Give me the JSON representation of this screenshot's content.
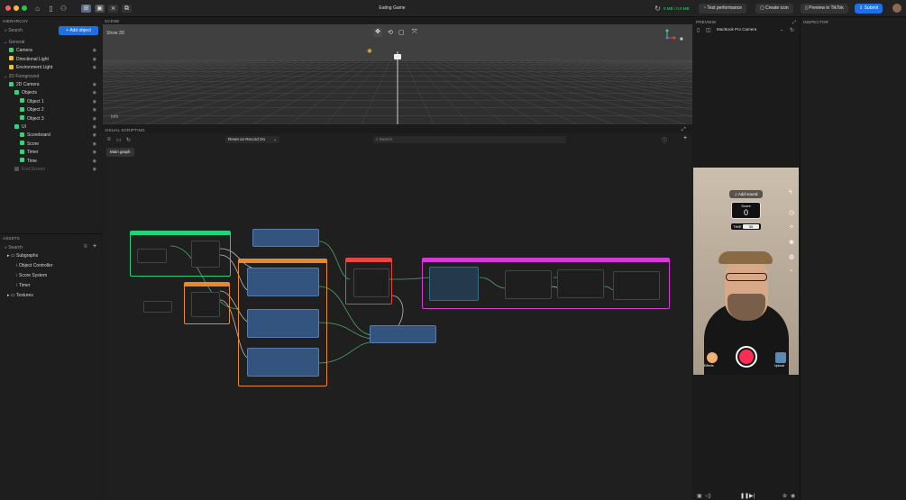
{
  "window": {
    "title": "Eating Game",
    "memory": "0 MB / 0.0 MB"
  },
  "toolbar": {
    "test_performance": "Test performance",
    "create_icon": "Create icon",
    "preview_tiktok": "Preview in TikTok",
    "submit": "Submit"
  },
  "hierarchy": {
    "title": "HIERARCHY",
    "search_placeholder": "Search",
    "add_object": "Add object",
    "rows": [
      {
        "label": "General",
        "indent": 0,
        "kind": "section"
      },
      {
        "label": "Camera",
        "indent": 1,
        "kind": "camera"
      },
      {
        "label": "Directional Light",
        "indent": 1,
        "kind": "light"
      },
      {
        "label": "Environment Light",
        "indent": 1,
        "kind": "light"
      },
      {
        "label": "2D Foreground",
        "indent": 0,
        "kind": "section"
      },
      {
        "label": "2D Camera",
        "indent": 1,
        "kind": "camera"
      },
      {
        "label": "Objects",
        "indent": 2,
        "kind": "group"
      },
      {
        "label": "Object 1",
        "indent": 3,
        "kind": "obj"
      },
      {
        "label": "Object 2",
        "indent": 3,
        "kind": "obj"
      },
      {
        "label": "Object 3",
        "indent": 3,
        "kind": "obj"
      },
      {
        "label": "UI",
        "indent": 2,
        "kind": "group"
      },
      {
        "label": "Scoreboard",
        "indent": 3,
        "kind": "obj"
      },
      {
        "label": "Score",
        "indent": 3,
        "kind": "obj"
      },
      {
        "label": "Timer",
        "indent": 3,
        "kind": "obj"
      },
      {
        "label": "Time",
        "indent": 3,
        "kind": "obj"
      },
      {
        "label": "End Screen",
        "indent": 2,
        "kind": "dim"
      }
    ]
  },
  "assets": {
    "title": "ASSETS",
    "search_placeholder": "Search",
    "rows": [
      {
        "label": "Subgraphs",
        "indent": 0
      },
      {
        "label": "Object Controller",
        "indent": 1
      },
      {
        "label": "Score System",
        "indent": 1
      },
      {
        "label": "Timer",
        "indent": 1
      },
      {
        "label": "Textures",
        "indent": 0
      }
    ]
  },
  "scene": {
    "title": "SCENE",
    "show3d": "Show 3D",
    "info": "Info"
  },
  "visual_scripting": {
    "title": "VISUAL SCRIPTING",
    "reset_option": "Reset on Record On",
    "search_placeholder": "Search",
    "tab": "Main graph"
  },
  "preview": {
    "title": "PREVIEW",
    "camera": "MacBook Pro Camera",
    "add_sound": "Add sound",
    "score_label": "Score",
    "score_value": "0",
    "time_label": "TIME",
    "time_value": "30",
    "effects": "Effects",
    "upload": "Upload"
  },
  "inspector": {
    "title": "INSPECTOR"
  },
  "colors": {
    "accent": "#1f6fe5",
    "group_green": "#27d17a",
    "group_orange": "#e88a2c",
    "group_red": "#e64545",
    "group_magenta": "#d63ad6"
  }
}
